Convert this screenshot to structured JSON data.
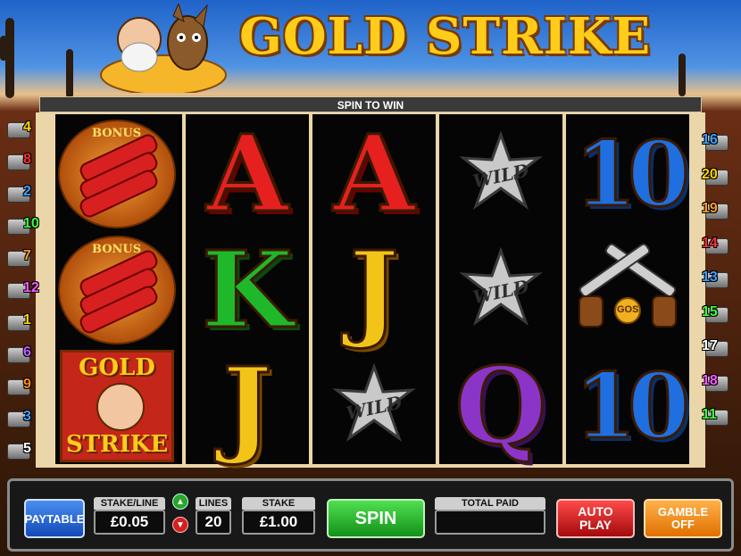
{
  "header": {
    "title": "GOLD STRIKE"
  },
  "info_bar": {
    "message": "SPIN TO WIN"
  },
  "reels": [
    [
      {
        "symbol": "bonus",
        "label": "BONUS"
      },
      {
        "symbol": "bonus",
        "label": "BONUS"
      },
      {
        "symbol": "logo",
        "label_top": "GOLD",
        "label_bottom": "STRIKE"
      }
    ],
    [
      {
        "symbol": "A",
        "text": "A"
      },
      {
        "symbol": "K",
        "text": "K"
      },
      {
        "symbol": "J",
        "text": "J"
      }
    ],
    [
      {
        "symbol": "A",
        "text": "A"
      },
      {
        "symbol": "J",
        "text": "J"
      },
      {
        "symbol": "wild",
        "text": "WILD"
      }
    ],
    [
      {
        "symbol": "wild",
        "text": "WILD"
      },
      {
        "symbol": "wild",
        "text": "WILD"
      },
      {
        "symbol": "Q",
        "text": "Q"
      }
    ],
    [
      {
        "symbol": "10",
        "text": "10"
      },
      {
        "symbol": "guns",
        "text": "GOS"
      },
      {
        "symbol": "10",
        "text": "10"
      }
    ]
  ],
  "paylines_left": [
    {
      "num": "4",
      "color": "#ffd400"
    },
    {
      "num": "8",
      "color": "#ff3030"
    },
    {
      "num": "2",
      "color": "#3da0ff"
    },
    {
      "num": "10",
      "color": "#3dff3d"
    },
    {
      "num": "7",
      "color": "#ff9a2a"
    },
    {
      "num": "12",
      "color": "#ff55ff"
    },
    {
      "num": "1",
      "color": "#ffd400"
    },
    {
      "num": "6",
      "color": "#c05cff"
    },
    {
      "num": "9",
      "color": "#ff8c1a"
    },
    {
      "num": "3",
      "color": "#3da0ff"
    },
    {
      "num": "5",
      "color": "#ffffff"
    }
  ],
  "paylines_right": [
    {
      "num": "16",
      "color": "#3da0ff"
    },
    {
      "num": "20",
      "color": "#ffd400"
    },
    {
      "num": "19",
      "color": "#ff9a2a"
    },
    {
      "num": "14",
      "color": "#ff3030"
    },
    {
      "num": "13",
      "color": "#3da0ff"
    },
    {
      "num": "15",
      "color": "#3dff3d"
    },
    {
      "num": "17",
      "color": "#ffffff"
    },
    {
      "num": "18",
      "color": "#ff55ff"
    },
    {
      "num": "11",
      "color": "#3dff3d"
    }
  ],
  "controls": {
    "paytable_label": "PAYTABLE",
    "stake_line_label": "STAKE/LINE",
    "stake_line_value": "£0.05",
    "lines_label": "LINES",
    "lines_value": "20",
    "stake_label": "STAKE",
    "stake_value": "£1.00",
    "spin_label": "SPIN",
    "total_paid_label": "TOTAL PAID",
    "total_paid_value": "",
    "autoplay_line1": "AUTO",
    "autoplay_line2": "PLAY",
    "gamble_line1": "GAMBLE",
    "gamble_line2": "OFF"
  },
  "colors": {
    "frame": "#ead6a8",
    "gold": "#ffcc1a",
    "spin_green": "#1fa81f",
    "autoplay_red": "#c01010",
    "gamble_orange": "#f08a10",
    "paytable_blue": "#2f6fdc"
  }
}
